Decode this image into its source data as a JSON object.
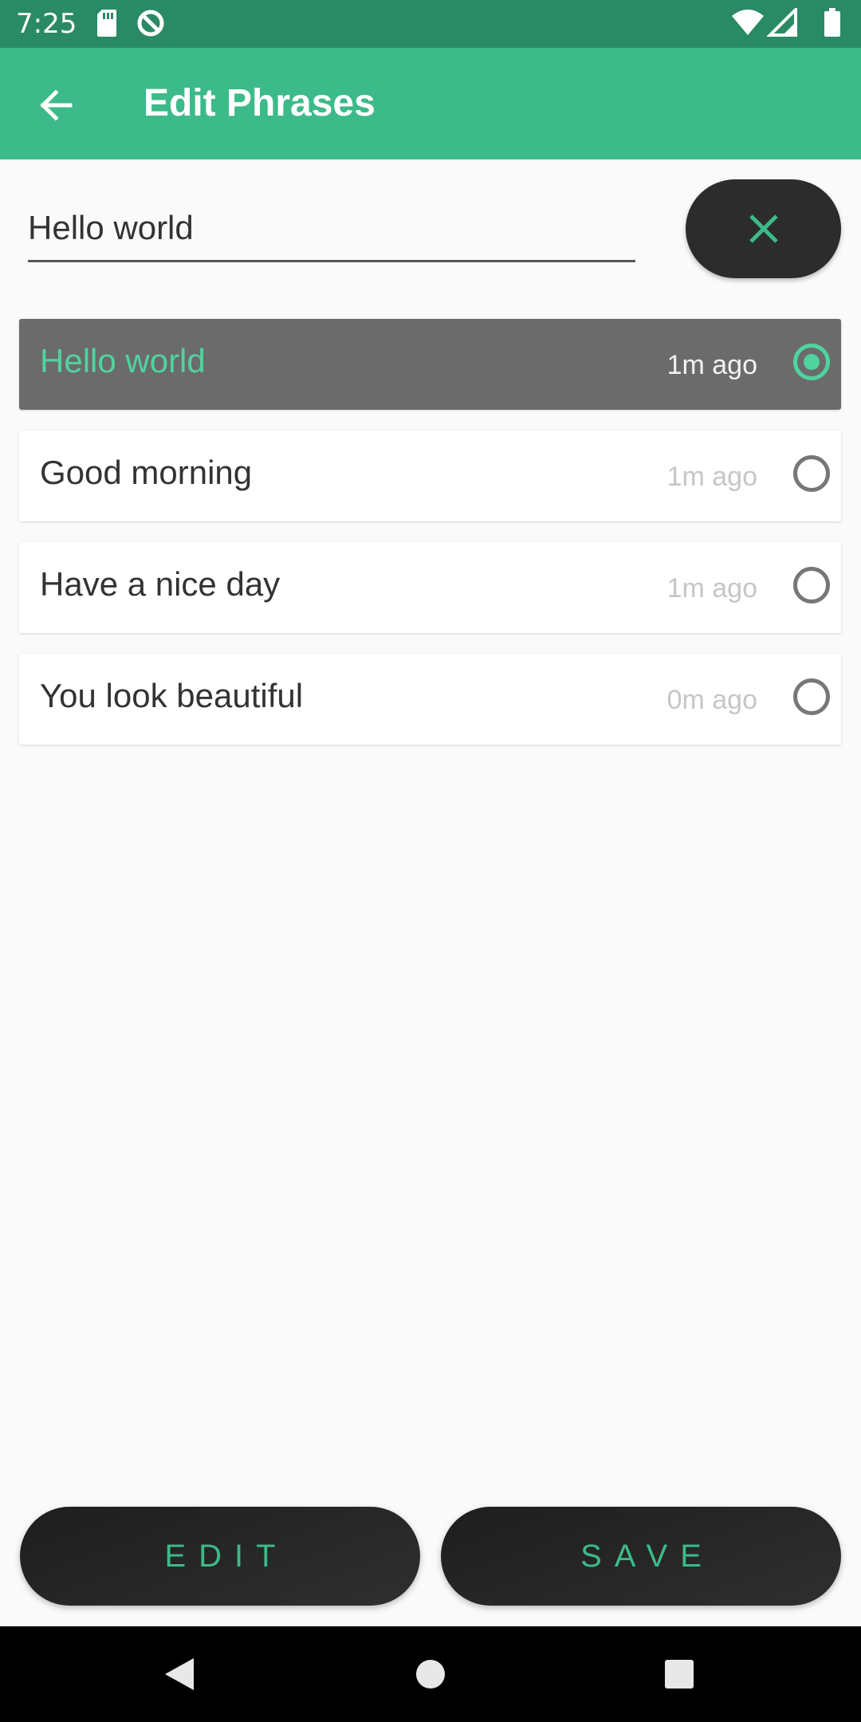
{
  "status_bar": {
    "time": "7:25",
    "left_icons": [
      "sd-card-icon",
      "do-not-disturb-icon"
    ],
    "right_icons": [
      "wifi-icon",
      "signal-icon",
      "battery-icon"
    ]
  },
  "app_bar": {
    "title": "Edit Phrases",
    "back_icon": "arrow-left-icon"
  },
  "editor": {
    "input_value": "Hello world",
    "clear_icon": "close-icon"
  },
  "phrases": [
    {
      "text": "Hello world",
      "time": "1m ago",
      "selected": true
    },
    {
      "text": "Good morning",
      "time": "1m ago",
      "selected": false
    },
    {
      "text": "Have a nice day",
      "time": "1m ago",
      "selected": false
    },
    {
      "text": "You look beautiful",
      "time": "0m ago",
      "selected": false
    }
  ],
  "actions": {
    "edit_label": "EDIT",
    "save_label": "SAVE"
  },
  "nav_bar": {
    "icons": [
      "nav-back-icon",
      "nav-home-icon",
      "nav-recents-icon"
    ]
  },
  "colors": {
    "status_bar": "#2a8a66",
    "app_bar": "#3cba8a",
    "accent": "#4fd3a0",
    "selected_row": "#6b6b6b",
    "button_dark": "#2c2c2c"
  }
}
